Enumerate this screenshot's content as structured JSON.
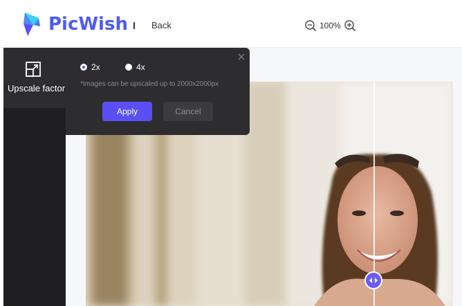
{
  "header": {
    "brand": "PicWish",
    "back_label": "Back",
    "zoom_level": "100%",
    "zoom_out_icon": "zoom-out-icon",
    "zoom_in_icon": "zoom-in-icon",
    "brand_color": "#4d5bf5"
  },
  "tool_panel": {
    "items": [
      {
        "label": "Upscale factor",
        "icon": "upscale-icon",
        "active": true
      }
    ]
  },
  "popover": {
    "options": [
      {
        "label": "2x",
        "selected": true
      },
      {
        "label": "4x",
        "selected": false
      }
    ],
    "note": "*Images can be upscaled up to 2000x2000px",
    "apply_label": "Apply",
    "cancel_label": "Cancel",
    "close_icon": "close-icon",
    "accent_color": "#5a4ff5"
  },
  "canvas": {
    "comparison_handle_icon": "compare-arrows-icon"
  }
}
